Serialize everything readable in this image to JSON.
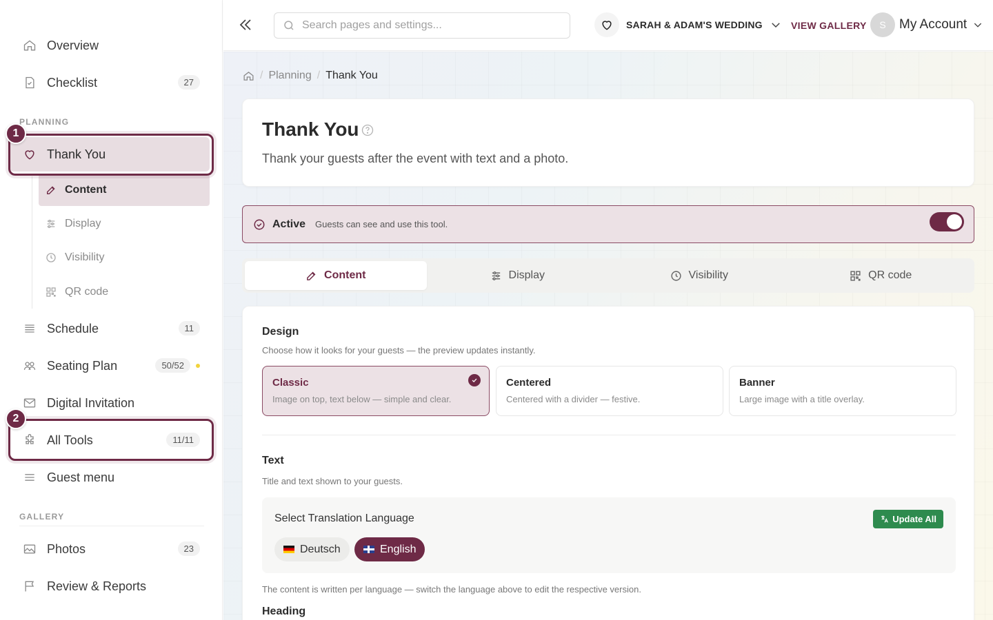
{
  "sidebar": {
    "items_top": [
      {
        "label": "Overview",
        "icon": "home-icon"
      },
      {
        "label": "Checklist",
        "icon": "checklist-icon",
        "badge": "27"
      }
    ],
    "planning_label": "PLANNING",
    "thank_you": {
      "label": "Thank You",
      "icon": "heart-icon"
    },
    "sub_items": [
      {
        "label": "Content",
        "icon": "edit-icon"
      },
      {
        "label": "Display",
        "icon": "sliders-icon"
      },
      {
        "label": "Visibility",
        "icon": "clock-icon"
      },
      {
        "label": "QR code",
        "icon": "qr-icon"
      }
    ],
    "items_mid": [
      {
        "label": "Schedule",
        "icon": "list-icon",
        "badge": "11"
      },
      {
        "label": "Seating Plan",
        "icon": "people-icon",
        "badge": "50/52"
      },
      {
        "label": "Digital Invitation",
        "icon": "mail-icon"
      },
      {
        "label": "All Tools",
        "icon": "puzzle-icon",
        "badge": "11/11"
      },
      {
        "label": "Guest menu",
        "icon": "menu-icon"
      }
    ],
    "gallery_label": "GALLERY",
    "items_gallery": [
      {
        "label": "Photos",
        "icon": "image-icon",
        "badge": "23"
      },
      {
        "label": "Review & Reports",
        "icon": "flag-icon"
      }
    ],
    "markers": [
      "1",
      "2"
    ]
  },
  "topbar": {
    "search_placeholder": "Search pages and settings...",
    "event_name": "SARAH & ADAM'S WEDDING",
    "view_gallery": "VIEW GALLERY",
    "avatar_initial": "S",
    "account_label": "My Account"
  },
  "breadcrumb": {
    "parent": "Planning",
    "current": "Thank You"
  },
  "page": {
    "title": "Thank You",
    "subtitle": "Thank your guests after the event with text and a photo."
  },
  "status": {
    "label": "Active",
    "description": "Guests can see and use this tool.",
    "enabled": true
  },
  "tabs": [
    {
      "label": "Content",
      "icon": "edit-icon",
      "active": true
    },
    {
      "label": "Display",
      "icon": "sliders-icon"
    },
    {
      "label": "Visibility",
      "icon": "clock-icon"
    },
    {
      "label": "QR code",
      "icon": "qr-icon"
    }
  ],
  "design": {
    "heading": "Design",
    "description": "Choose how it looks for your guests — the preview updates instantly.",
    "options": [
      {
        "title": "Classic",
        "desc": "Image on top, text below — simple and clear.",
        "selected": true
      },
      {
        "title": "Centered",
        "desc": "Centered with a divider — festive."
      },
      {
        "title": "Banner",
        "desc": "Large image with a title overlay."
      }
    ]
  },
  "text_section": {
    "heading": "Text",
    "description": "Title and text shown to your guests.",
    "lang_title": "Select Translation Language",
    "update_all": "Update All",
    "languages": [
      {
        "label": "Deutsch",
        "selected": false
      },
      {
        "label": "English",
        "selected": true
      }
    ],
    "note": "The content is written per language — switch the language above to edit the respective version.",
    "next_heading": "Heading"
  },
  "colors": {
    "accent": "#6e2a46",
    "accent_bg": "#ece1e5",
    "success": "#2e8b4e"
  }
}
